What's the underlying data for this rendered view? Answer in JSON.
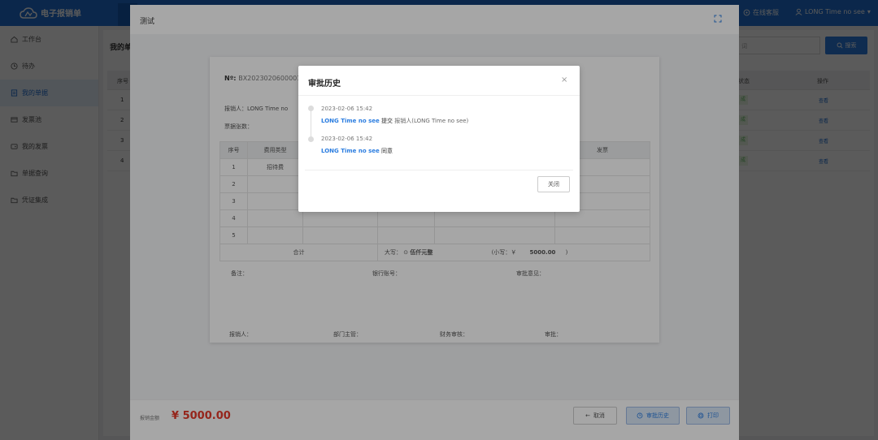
{
  "app": {
    "title": "电子报销单"
  },
  "topbar": {
    "online_service": "在线客服",
    "user": "LONG Time no see"
  },
  "sidebar": {
    "items": [
      {
        "label": "工作台"
      },
      {
        "label": "待办"
      },
      {
        "label": "我的单据"
      },
      {
        "label": "发票池"
      },
      {
        "label": "我的发票"
      },
      {
        "label": "单据查询"
      },
      {
        "label": "凭证集成"
      }
    ]
  },
  "bg": {
    "title": "我的单",
    "search_placeholder": "词",
    "search_button": "搜索",
    "headers": {
      "index": "序号",
      "status": "状态",
      "action": "操作"
    },
    "rows": [
      {
        "index": "1",
        "status": "成",
        "action": "查看"
      },
      {
        "index": "2",
        "status": "成",
        "action": "查看"
      },
      {
        "index": "3",
        "status": "成",
        "action": "查看"
      },
      {
        "index": "4",
        "status": "成",
        "action": "查看"
      }
    ]
  },
  "dialog": {
    "title": "测试",
    "bill": {
      "no_label": "Nº:",
      "no_value": "BX2023020600001",
      "reporter_line": "报销人：LONG Time no",
      "receipts_line": "票据张数：",
      "headers": [
        "序号",
        "费用类型",
        "",
        "",
        "",
        "发票"
      ],
      "rows": [
        {
          "index": "1",
          "type": "招待费"
        },
        {
          "index": "2",
          "type": ""
        },
        {
          "index": "3",
          "type": ""
        },
        {
          "index": "4",
          "type": ""
        },
        {
          "index": "5",
          "type": ""
        }
      ],
      "total_label": "合计",
      "uppercase_label": "大写：",
      "uppercase_value": "伍仟元整",
      "lowercase_label": "(小写：￥",
      "lowercase_value": "5000.00",
      "lowercase_close": ")",
      "remark": "备注：",
      "bank": "银行账号：",
      "opinion": "审批意见：",
      "sign_reporter": "报销人：",
      "sign_manager": "部门主管：",
      "sign_finance": "财务审核：",
      "sign_approve": "审批："
    },
    "footer": {
      "amount_label": "报销金额",
      "amount": "¥ 5000.00",
      "cancel": "取消",
      "history": "审批历史",
      "print": "打印"
    }
  },
  "modal": {
    "title": "审批历史",
    "close_icon": "×",
    "entries": [
      {
        "time": "2023-02-06 15:42",
        "user": "LONG Time no see",
        "action": "提交",
        "detail": "报销人(LONG Time no see)"
      },
      {
        "time": "2023-02-06 15:42",
        "user": "LONG Time no see",
        "action": "同意",
        "detail": ""
      }
    ],
    "close_button": "关闭"
  },
  "colors": {
    "primary": "#1f6fd1",
    "amount": "#e5392a",
    "link": "#2b7de0"
  }
}
